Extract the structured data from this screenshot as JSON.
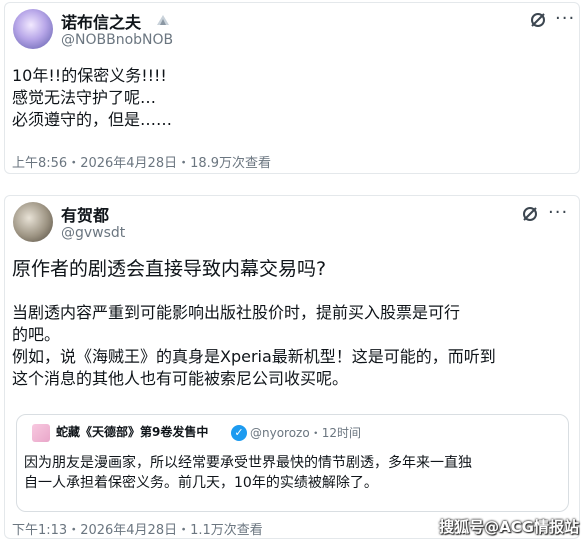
{
  "tweet1": {
    "display_name": "诺布信之夫",
    "handle": "@NOBBnobNOB",
    "lines": [
      "10年!!的保密义务!!!!",
      "感觉无法守护了呢…",
      "必须遵守的，但是……"
    ],
    "meta": "上午8:56・2026年4月28日・18.9万次查看"
  },
  "tweet2": {
    "display_name": "有贺都",
    "handle": "@gvwsdt",
    "headline": "原作者的剧透会直接导致内幕交易吗?",
    "lines": [
      "当剧透内容严重到可能影响出版社股价时，提前买入股票是可行",
      "的吧。",
      "例如，说《海贼王》的真身是Xperia最新机型！这是可能的，而听到",
      "这个消息的其他人也有可能被索尼公司收买呢。"
    ],
    "quote": {
      "author": "蛇藏《天德部》第9卷发售中",
      "handle": "@nyorozo・12时间",
      "lines": [
        "因为朋友是漫画家，所以经常要承受世界最快的情节剧透，多年来一直独",
        "自一人承担着保密义务。前几天，10年的实绩被解除了。"
      ]
    },
    "meta": "下午1:13・2026年4月28日・1.1万次查看"
  },
  "watermark": "搜狐号@ACG情报站"
}
